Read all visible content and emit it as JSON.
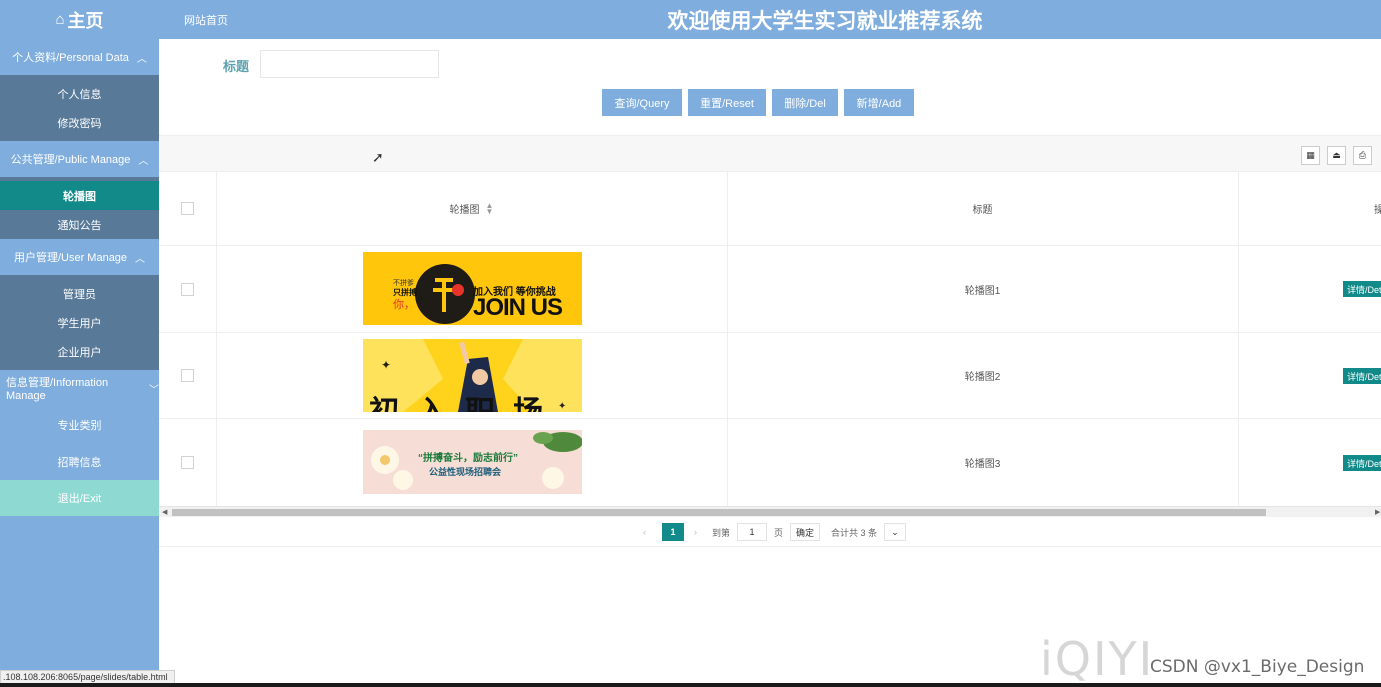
{
  "header": {
    "home_label": "主页",
    "site_home_link": "网站首页",
    "system_title": "欢迎使用大学生实习就业推荐系统"
  },
  "sidebar": {
    "groups": [
      {
        "label": "个人资料/Personal Data",
        "items": [
          "个人信息",
          "修改密码"
        ]
      },
      {
        "label": "公共管理/Public Manage",
        "items": [
          "轮播图",
          "通知公告"
        ]
      },
      {
        "label": "用户管理/User Manage",
        "items": [
          "管理员",
          "学生用户",
          "企业用户"
        ]
      },
      {
        "label": "信息管理/Information Manage",
        "items": [
          "专业类别",
          "招聘信息"
        ]
      }
    ],
    "active_item": "轮播图",
    "exit_label": "退出/Exit"
  },
  "search": {
    "label": "标题",
    "value": ""
  },
  "actions": {
    "query": "查询/Query",
    "reset": "重置/Reset",
    "delete": "删除/Del",
    "add": "新增/Add"
  },
  "table": {
    "columns": [
      "轮播图",
      "标题",
      "操作"
    ],
    "rows": [
      {
        "title": "轮播图1",
        "action": "详情/Det",
        "banner": {
          "left_small": "不拼爹",
          "left_line2": "只拼搏",
          "left_line3": "你，",
          "headline": "加入我们  等你挑战",
          "big": "JOIN US"
        }
      },
      {
        "title": "轮播图2",
        "action": "详情/Det",
        "banner": {
          "big": "初入职场"
        }
      },
      {
        "title": "轮播图3",
        "action": "详情/Det",
        "banner": {
          "headline": "“拼搏奋斗，励志前行”",
          "sub": "公益性现场招聘会"
        }
      }
    ]
  },
  "pagination": {
    "current_page": "1",
    "goto_label": "到第",
    "goto_value": "1",
    "page_unit": "页",
    "confirm": "确定",
    "total": "合计共 3 条"
  },
  "status_url": ".108.108.206:8065/page/slides/table.html",
  "watermark": {
    "brand": "iQIYI",
    "csdn": "CSDN @vx1_Biye_Design"
  },
  "colors": {
    "nav_blue": "#7faddd",
    "sub_dark": "#587a98",
    "active_teal": "#138a8a",
    "exit_mint": "#8edad3"
  }
}
